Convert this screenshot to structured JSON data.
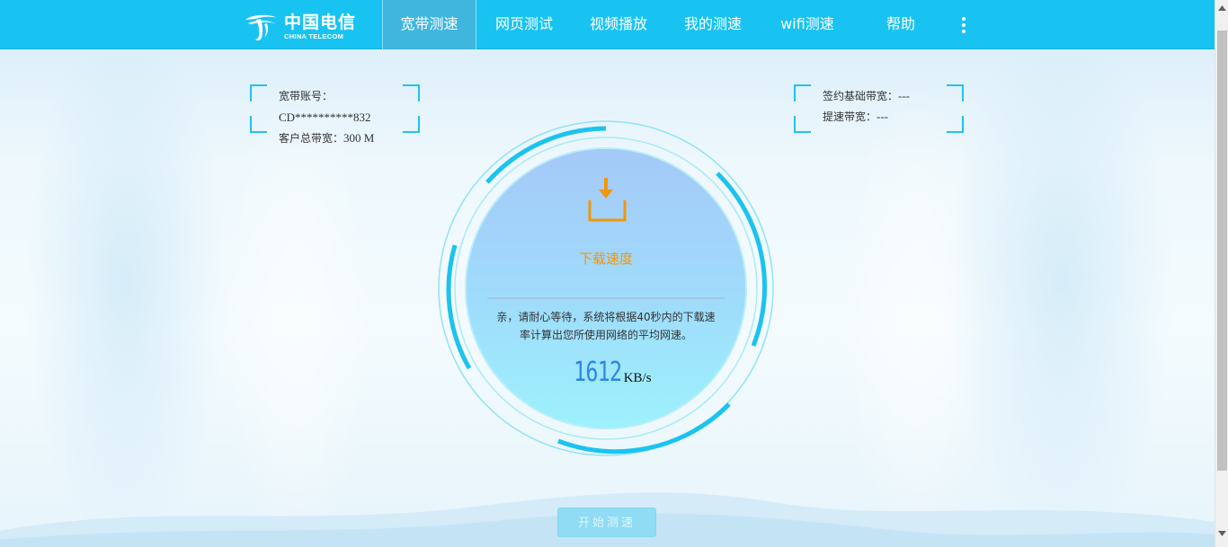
{
  "nav": {
    "logo_cn": "中国电信",
    "logo_en": "CHINA TELECOM",
    "items": [
      {
        "label": "宽带测速",
        "active": true
      },
      {
        "label": "网页测试",
        "active": false
      },
      {
        "label": "视频播放",
        "active": false
      },
      {
        "label": "我的测速",
        "active": false
      },
      {
        "label": "wifi测速",
        "active": false
      },
      {
        "label": "帮助",
        "active": false
      }
    ],
    "more_icon": "more-vertical-icon"
  },
  "account": {
    "account_label": "宽带账号：",
    "account_value": "CD**********832",
    "total_bw_label": "客户总带宽：",
    "total_bw_value": "300 M"
  },
  "contract": {
    "base_bw_label": "签约基础带宽：",
    "base_bw_value": "---",
    "boost_bw_label": "提速带宽：",
    "boost_bw_value": "---"
  },
  "gauge": {
    "icon": "download-icon",
    "label": "下载速度",
    "message": "亲，请耐心等待，系统将根据40秒内的下载速率计算出您所使用网络的平均网速。",
    "speed_value": "1612",
    "speed_unit": "KB/s"
  },
  "start_button": "开始测速",
  "colors": {
    "nav_bg": "#18c3f2",
    "accent": "#21c2ef",
    "label_orange": "#f2960d",
    "speed_blue": "#2c86e8"
  }
}
